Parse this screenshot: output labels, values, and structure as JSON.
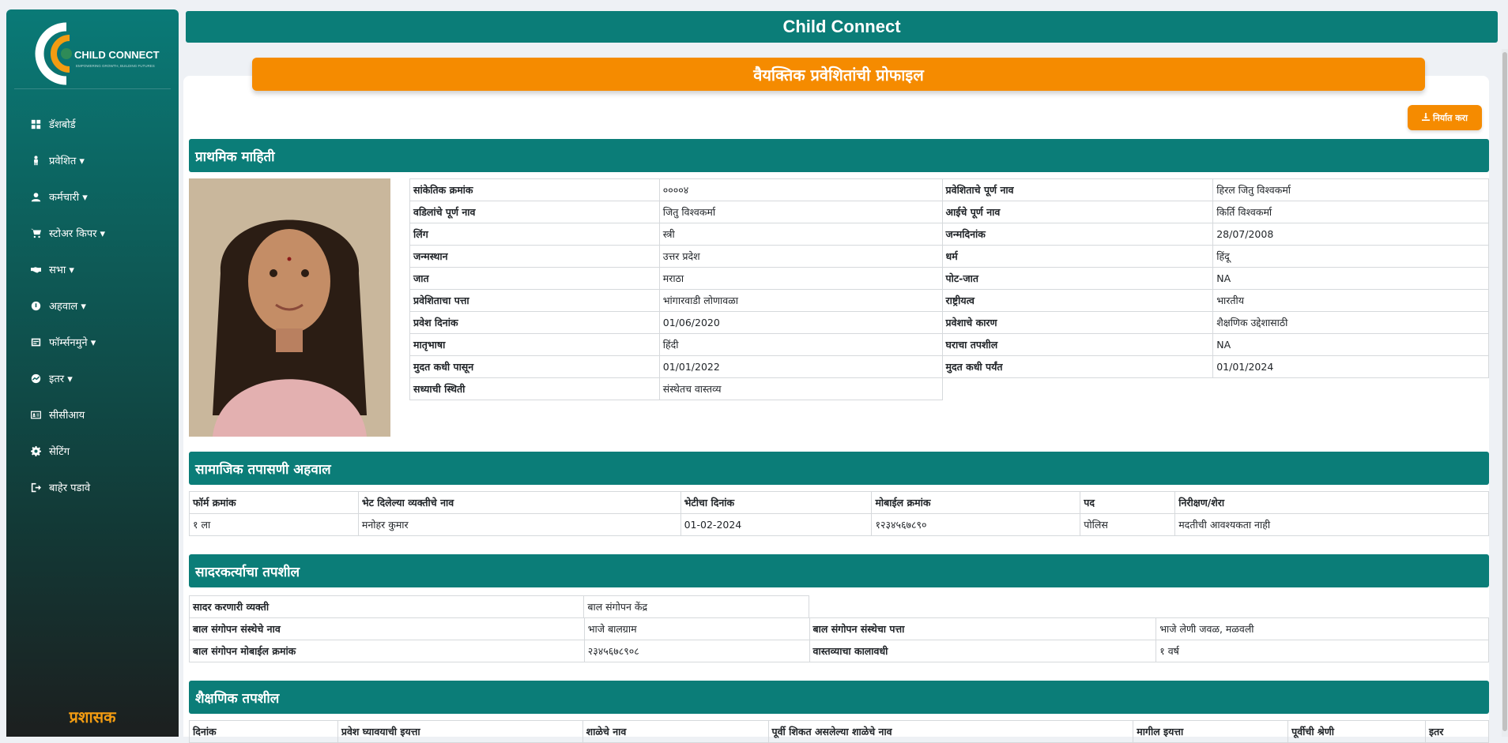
{
  "app": {
    "brand": "CHILD CONNECT",
    "brand_tagline": "EMPOWERING GROWTH, BUILDING FUTURES",
    "header_title": "Child Connect",
    "role_label": "प्रशासक"
  },
  "sidebar": {
    "items": [
      {
        "label": "डॅशबोर्ड",
        "icon": "dashboard-icon"
      },
      {
        "label": "प्रवेशित ▾",
        "icon": "person-icon"
      },
      {
        "label": "कर्मचारी ▾",
        "icon": "user-icon"
      },
      {
        "label": "स्टोअर किपर ▾",
        "icon": "cart-icon"
      },
      {
        "label": "सभा ▾",
        "icon": "handshake-icon"
      },
      {
        "label": "अहवाल ▾",
        "icon": "report-icon"
      },
      {
        "label": "फॉर्म्सनमुने ▾",
        "icon": "forms-icon"
      },
      {
        "label": "इतर ▾",
        "icon": "chart-icon"
      },
      {
        "label": "सीसीआय",
        "icon": "id-card-icon"
      },
      {
        "label": "सेटिंग",
        "icon": "gear-icon"
      },
      {
        "label": "बाहेर पडावे",
        "icon": "logout-icon"
      }
    ]
  },
  "page": {
    "title": "वैयक्तिक प्रवेशितांची प्रोफाइल",
    "export_label": "निर्यात करा"
  },
  "primary": {
    "heading": "प्राथमिक माहिती",
    "rows": [
      [
        "सांकेतिक क्रमांक",
        "००००४",
        "प्रवेशिताचे पूर्ण नाव",
        "हिरल जितु विश्वकर्मा"
      ],
      [
        "वडिलांचे पूर्ण नाव",
        "जितु विश्वकर्मा",
        "आईचे पूर्ण नाव",
        "किर्ति विश्वकर्मा"
      ],
      [
        "लिंग",
        "स्त्री",
        "जन्मदिनांक",
        "28/07/2008"
      ],
      [
        "जन्मस्थान",
        "उत्तर प्रदेश",
        "धर्म",
        "हिंदू"
      ],
      [
        "जात",
        "मराठा",
        "पोट-जात",
        "NA"
      ],
      [
        "प्रवेशिताचा पत्ता",
        "भांगारवाडी लोणावळा",
        "राष्ट्रीयत्व",
        "भारतीय"
      ],
      [
        "प्रवेश दिनांक",
        "01/06/2020",
        "प्रवेशाचे कारण",
        "शैक्षणिक उद्देशासाठी"
      ],
      [
        "मातृभाषा",
        "हिंदी",
        "घराचा तपशील",
        "NA"
      ],
      [
        "मुदत कधी पासून",
        "01/01/2022",
        "मुदत कधी पर्यंत",
        "01/01/2024"
      ],
      [
        "सध्याची स्थिती",
        "संस्थेतच वास्तव्य",
        "",
        ""
      ]
    ]
  },
  "social": {
    "heading": "सामाजिक तपासणी अहवाल",
    "columns": [
      "फॉर्म क्रमांक",
      "भेट दिलेल्या व्यक्तीचे नाव",
      "भेटीचा दिनांक",
      "मोबाईल क्रमांक",
      "पद",
      "निरीक्षण/शेरा"
    ],
    "rows": [
      [
        "१ ला",
        "मनोहर कुमार",
        "01-02-2024",
        "१२३४५६७८९०",
        "पोलिस",
        "मदतीची आवश्यकता नाही"
      ]
    ]
  },
  "presenter": {
    "heading": "सादरकर्त्याचा तपशील",
    "row1": [
      "सादर करणारी व्यक्ती",
      "बाल संगोपन केंद्र"
    ],
    "rows": [
      [
        "बाल संगोपन संस्थेचे नाव",
        "भाजे बालग्राम",
        "बाल संगोपन संस्थेचा पत्ता",
        "भाजे लेणी जवळ, मळवली"
      ],
      [
        "बाल संगोपन मोबाईल क्रमांक",
        "२३४५६७८९०८",
        "वास्तव्याचा कालावधी",
        "१ वर्ष"
      ]
    ]
  },
  "education": {
    "heading": "शैक्षणिक तपशील",
    "columns": [
      "दिनांक",
      "प्रवेश घ्यावयाची इयत्ता",
      "शाळेचे नाव",
      "पूर्वी शिकत असलेल्या शाळेचे नाव",
      "मागील इयत्ता",
      "पूर्वीची श्रेणी",
      "इतर"
    ]
  },
  "colors": {
    "teal": "#0b7d78",
    "orange": "#f58b00",
    "role_orange": "#f39c12"
  }
}
